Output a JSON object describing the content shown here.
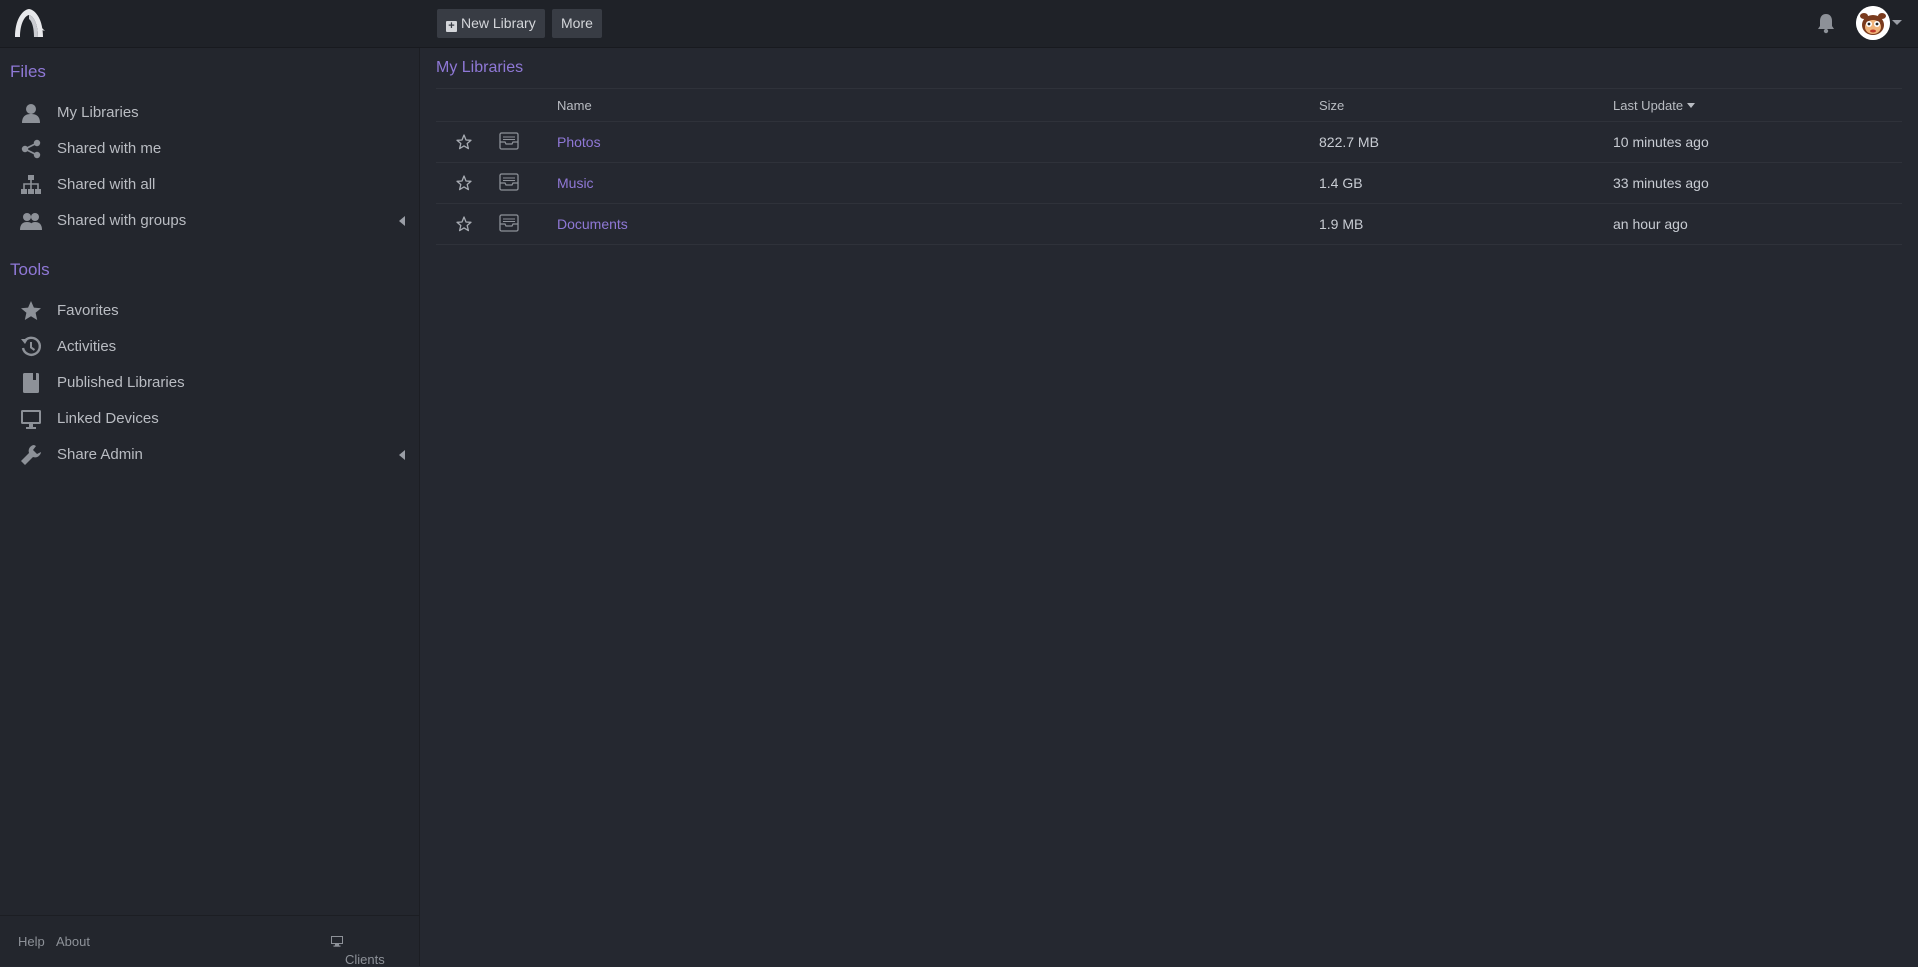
{
  "header": {
    "new_library_label": "New Library",
    "more_label": "More"
  },
  "sidebar": {
    "files_title": "Files",
    "files_items": [
      {
        "label": "My Libraries",
        "icon": "user-icon"
      },
      {
        "label": "Shared with me",
        "icon": "share-icon"
      },
      {
        "label": "Shared with all",
        "icon": "org-chart-icon"
      },
      {
        "label": "Shared with groups",
        "icon": "group-icon"
      }
    ],
    "tools_title": "Tools",
    "tools_items": [
      {
        "label": "Favorites",
        "icon": "star-icon"
      },
      {
        "label": "Activities",
        "icon": "history-icon"
      },
      {
        "label": "Published Libraries",
        "icon": "book-icon"
      },
      {
        "label": "Linked Devices",
        "icon": "monitor-icon"
      },
      {
        "label": "Share Admin",
        "icon": "wrench-icon"
      }
    ],
    "footer": {
      "help": "Help",
      "about": "About",
      "clients": "Clients"
    }
  },
  "main": {
    "title": "My Libraries",
    "columns": {
      "name": "Name",
      "size": "Size",
      "last_update": "Last Update"
    },
    "rows": [
      {
        "name": "Photos",
        "size": "822.7 MB",
        "updated": "10 minutes ago"
      },
      {
        "name": "Music",
        "size": "1.4 GB",
        "updated": "33 minutes ago"
      },
      {
        "name": "Documents",
        "size": "1.9 MB",
        "updated": "an hour ago"
      }
    ]
  },
  "colors": {
    "accent": "#8f78d6",
    "background": "#252830",
    "sidebar": "#23262d",
    "topbar": "#1f2228"
  }
}
